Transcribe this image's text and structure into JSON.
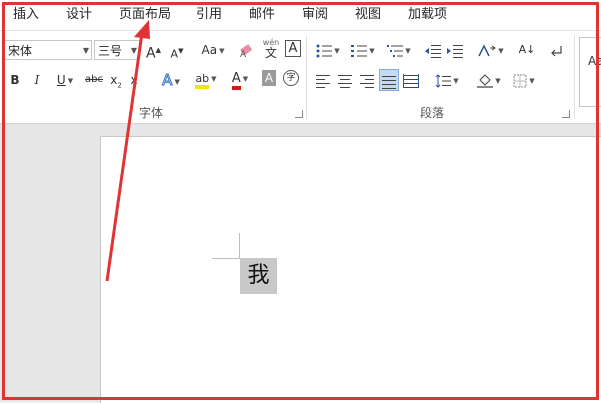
{
  "tabs": [
    "插入",
    "设计",
    "页面布局",
    "引用",
    "邮件",
    "审阅",
    "视图",
    "加载项"
  ],
  "font": {
    "name": "宋体",
    "size": "三号"
  },
  "toolbar": {
    "grow_font": "A",
    "shrink_font": "A",
    "change_case": "Aa",
    "phonetic": "wén",
    "phonetic_char": "文",
    "char_border": "A",
    "bold": "B",
    "italic": "I",
    "underline": "U",
    "strike": "abc",
    "subscript": "x",
    "subscript_mark": "2",
    "superscript": "x",
    "highlight": "ab",
    "font_color": "A",
    "char_shading": "A",
    "enclose": "字",
    "sort": "A↓",
    "styles_sample": "Aa"
  },
  "groups": {
    "font_label": "字体",
    "paragraph_label": "段落"
  },
  "document": {
    "char": "我"
  },
  "colors": {
    "highlight": "#f2e500",
    "font_color": "#d21a1a",
    "annotation": "#e03434"
  }
}
